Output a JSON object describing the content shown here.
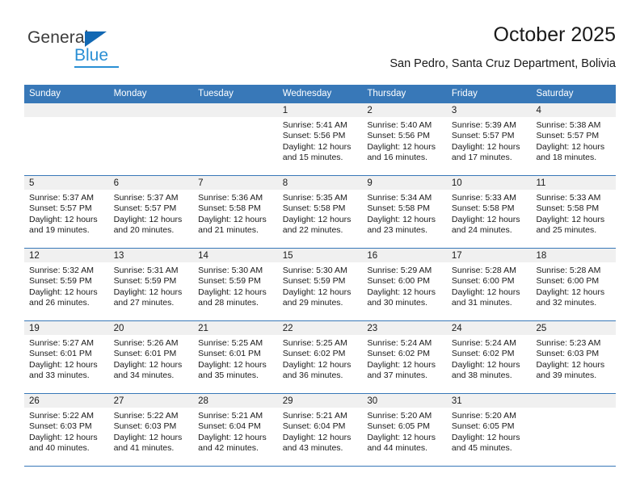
{
  "logo": {
    "word_general": "General",
    "word_blue": "Blue",
    "triangle_color": "#1268b3",
    "blue_color": "#2a8fd4"
  },
  "header": {
    "title": "October 2025",
    "subtitle": "San Pedro, Santa Cruz Department, Bolivia",
    "header_bg": "#3878b8",
    "band_bg": "#f0f0f0"
  },
  "weekdays": [
    "Sunday",
    "Monday",
    "Tuesday",
    "Wednesday",
    "Thursday",
    "Friday",
    "Saturday"
  ],
  "weeks": [
    [
      {
        "day": "",
        "empty": true
      },
      {
        "day": "",
        "empty": true
      },
      {
        "day": "",
        "empty": true
      },
      {
        "day": "1",
        "sunrise": "Sunrise: 5:41 AM",
        "sunset": "Sunset: 5:56 PM",
        "daylight1": "Daylight: 12 hours",
        "daylight2": "and 15 minutes."
      },
      {
        "day": "2",
        "sunrise": "Sunrise: 5:40 AM",
        "sunset": "Sunset: 5:56 PM",
        "daylight1": "Daylight: 12 hours",
        "daylight2": "and 16 minutes."
      },
      {
        "day": "3",
        "sunrise": "Sunrise: 5:39 AM",
        "sunset": "Sunset: 5:57 PM",
        "daylight1": "Daylight: 12 hours",
        "daylight2": "and 17 minutes."
      },
      {
        "day": "4",
        "sunrise": "Sunrise: 5:38 AM",
        "sunset": "Sunset: 5:57 PM",
        "daylight1": "Daylight: 12 hours",
        "daylight2": "and 18 minutes."
      }
    ],
    [
      {
        "day": "5",
        "sunrise": "Sunrise: 5:37 AM",
        "sunset": "Sunset: 5:57 PM",
        "daylight1": "Daylight: 12 hours",
        "daylight2": "and 19 minutes."
      },
      {
        "day": "6",
        "sunrise": "Sunrise: 5:37 AM",
        "sunset": "Sunset: 5:57 PM",
        "daylight1": "Daylight: 12 hours",
        "daylight2": "and 20 minutes."
      },
      {
        "day": "7",
        "sunrise": "Sunrise: 5:36 AM",
        "sunset": "Sunset: 5:58 PM",
        "daylight1": "Daylight: 12 hours",
        "daylight2": "and 21 minutes."
      },
      {
        "day": "8",
        "sunrise": "Sunrise: 5:35 AM",
        "sunset": "Sunset: 5:58 PM",
        "daylight1": "Daylight: 12 hours",
        "daylight2": "and 22 minutes."
      },
      {
        "day": "9",
        "sunrise": "Sunrise: 5:34 AM",
        "sunset": "Sunset: 5:58 PM",
        "daylight1": "Daylight: 12 hours",
        "daylight2": "and 23 minutes."
      },
      {
        "day": "10",
        "sunrise": "Sunrise: 5:33 AM",
        "sunset": "Sunset: 5:58 PM",
        "daylight1": "Daylight: 12 hours",
        "daylight2": "and 24 minutes."
      },
      {
        "day": "11",
        "sunrise": "Sunrise: 5:33 AM",
        "sunset": "Sunset: 5:58 PM",
        "daylight1": "Daylight: 12 hours",
        "daylight2": "and 25 minutes."
      }
    ],
    [
      {
        "day": "12",
        "sunrise": "Sunrise: 5:32 AM",
        "sunset": "Sunset: 5:59 PM",
        "daylight1": "Daylight: 12 hours",
        "daylight2": "and 26 minutes."
      },
      {
        "day": "13",
        "sunrise": "Sunrise: 5:31 AM",
        "sunset": "Sunset: 5:59 PM",
        "daylight1": "Daylight: 12 hours",
        "daylight2": "and 27 minutes."
      },
      {
        "day": "14",
        "sunrise": "Sunrise: 5:30 AM",
        "sunset": "Sunset: 5:59 PM",
        "daylight1": "Daylight: 12 hours",
        "daylight2": "and 28 minutes."
      },
      {
        "day": "15",
        "sunrise": "Sunrise: 5:30 AM",
        "sunset": "Sunset: 5:59 PM",
        "daylight1": "Daylight: 12 hours",
        "daylight2": "and 29 minutes."
      },
      {
        "day": "16",
        "sunrise": "Sunrise: 5:29 AM",
        "sunset": "Sunset: 6:00 PM",
        "daylight1": "Daylight: 12 hours",
        "daylight2": "and 30 minutes."
      },
      {
        "day": "17",
        "sunrise": "Sunrise: 5:28 AM",
        "sunset": "Sunset: 6:00 PM",
        "daylight1": "Daylight: 12 hours",
        "daylight2": "and 31 minutes."
      },
      {
        "day": "18",
        "sunrise": "Sunrise: 5:28 AM",
        "sunset": "Sunset: 6:00 PM",
        "daylight1": "Daylight: 12 hours",
        "daylight2": "and 32 minutes."
      }
    ],
    [
      {
        "day": "19",
        "sunrise": "Sunrise: 5:27 AM",
        "sunset": "Sunset: 6:01 PM",
        "daylight1": "Daylight: 12 hours",
        "daylight2": "and 33 minutes."
      },
      {
        "day": "20",
        "sunrise": "Sunrise: 5:26 AM",
        "sunset": "Sunset: 6:01 PM",
        "daylight1": "Daylight: 12 hours",
        "daylight2": "and 34 minutes."
      },
      {
        "day": "21",
        "sunrise": "Sunrise: 5:25 AM",
        "sunset": "Sunset: 6:01 PM",
        "daylight1": "Daylight: 12 hours",
        "daylight2": "and 35 minutes."
      },
      {
        "day": "22",
        "sunrise": "Sunrise: 5:25 AM",
        "sunset": "Sunset: 6:02 PM",
        "daylight1": "Daylight: 12 hours",
        "daylight2": "and 36 minutes."
      },
      {
        "day": "23",
        "sunrise": "Sunrise: 5:24 AM",
        "sunset": "Sunset: 6:02 PM",
        "daylight1": "Daylight: 12 hours",
        "daylight2": "and 37 minutes."
      },
      {
        "day": "24",
        "sunrise": "Sunrise: 5:24 AM",
        "sunset": "Sunset: 6:02 PM",
        "daylight1": "Daylight: 12 hours",
        "daylight2": "and 38 minutes."
      },
      {
        "day": "25",
        "sunrise": "Sunrise: 5:23 AM",
        "sunset": "Sunset: 6:03 PM",
        "daylight1": "Daylight: 12 hours",
        "daylight2": "and 39 minutes."
      }
    ],
    [
      {
        "day": "26",
        "sunrise": "Sunrise: 5:22 AM",
        "sunset": "Sunset: 6:03 PM",
        "daylight1": "Daylight: 12 hours",
        "daylight2": "and 40 minutes."
      },
      {
        "day": "27",
        "sunrise": "Sunrise: 5:22 AM",
        "sunset": "Sunset: 6:03 PM",
        "daylight1": "Daylight: 12 hours",
        "daylight2": "and 41 minutes."
      },
      {
        "day": "28",
        "sunrise": "Sunrise: 5:21 AM",
        "sunset": "Sunset: 6:04 PM",
        "daylight1": "Daylight: 12 hours",
        "daylight2": "and 42 minutes."
      },
      {
        "day": "29",
        "sunrise": "Sunrise: 5:21 AM",
        "sunset": "Sunset: 6:04 PM",
        "daylight1": "Daylight: 12 hours",
        "daylight2": "and 43 minutes."
      },
      {
        "day": "30",
        "sunrise": "Sunrise: 5:20 AM",
        "sunset": "Sunset: 6:05 PM",
        "daylight1": "Daylight: 12 hours",
        "daylight2": "and 44 minutes."
      },
      {
        "day": "31",
        "sunrise": "Sunrise: 5:20 AM",
        "sunset": "Sunset: 6:05 PM",
        "daylight1": "Daylight: 12 hours",
        "daylight2": "and 45 minutes."
      },
      {
        "day": "",
        "empty": true
      }
    ]
  ]
}
